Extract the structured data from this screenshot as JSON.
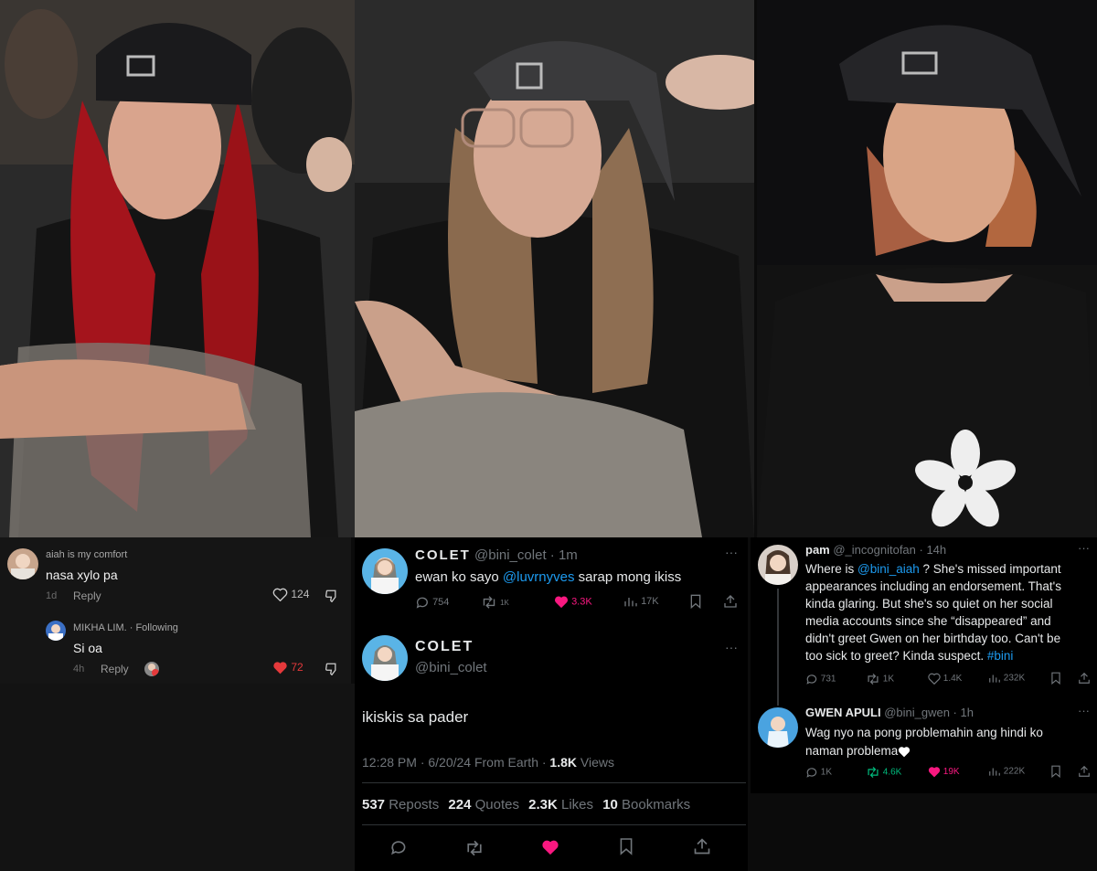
{
  "colors": {
    "accent": "#1d9bf0",
    "like": "#f91880",
    "repost": "#00ba7c",
    "muted": "#71767b",
    "text": "#e7e9ea"
  },
  "photos": [
    {
      "icon": "photo-redhair-cap"
    },
    {
      "icon": "photo-brownhair-glasses-cap"
    },
    {
      "icon": "photo-shorthair-cap-flower-shirt"
    }
  ],
  "tiktok": {
    "comment": {
      "user": "aiah is my comfort",
      "text": "nasa xylo pa",
      "time": "1d",
      "reply": "Reply",
      "likes": "124"
    },
    "reply": {
      "user": "MIKHA LIM.",
      "following": " · Following",
      "text": "Si oa",
      "time": "4h",
      "reply": "Reply",
      "likes": "72"
    }
  },
  "tweet1": {
    "name": "COLET",
    "handle": "@bini_colet",
    "time": "· 1m",
    "text_a": "ewan ko sayo ",
    "mention": "@luvrnyves",
    "text_b": " sarap mong ikiss",
    "replies": "754",
    "reposts": "1K",
    "likes": "3.3K",
    "views": "17K"
  },
  "tweet2": {
    "name": "COLET",
    "handle": "@bini_colet",
    "text": "ikiskis sa pader",
    "timestamp": "12:28 PM · 6/20/24 From Earth · ",
    "views_count": "1.8K",
    "views_label": " Views",
    "stats": [
      {
        "n": "537",
        "label": " Reposts"
      },
      {
        "n": "224",
        "label": " Quotes"
      },
      {
        "n": "2.3K",
        "label": " Likes"
      },
      {
        "n": "10",
        "label": " Bookmarks"
      }
    ]
  },
  "tweet3": {
    "name": "pam",
    "handle": "@_incognitofan · 14h",
    "l1a": "Where is ",
    "l1m": "@bini_aiah",
    "l1b": " ? She's missed important",
    "l2": "appearances including an endorsement. That's",
    "l3": "kinda glaring. But she's so quiet on her social",
    "l4": "media accounts since she “disappeared” and",
    "l5": "didn't greet Gwen on her birthday too. Can't be",
    "l6a": "too sick to greet? Kinda suspect. ",
    "l6h": "#bini",
    "replies": "731",
    "reposts": "1K",
    "likes": "1.4K",
    "views": "232K"
  },
  "tweet4": {
    "name": "GWEN APULI",
    "handle": "@bini_gwen · 1h",
    "l1": "Wag nyo na pong problemahin ang hindi ko",
    "l2": "naman problema",
    "replies": "1K",
    "reposts": "4.6K",
    "likes": "19K",
    "views": "222K"
  }
}
